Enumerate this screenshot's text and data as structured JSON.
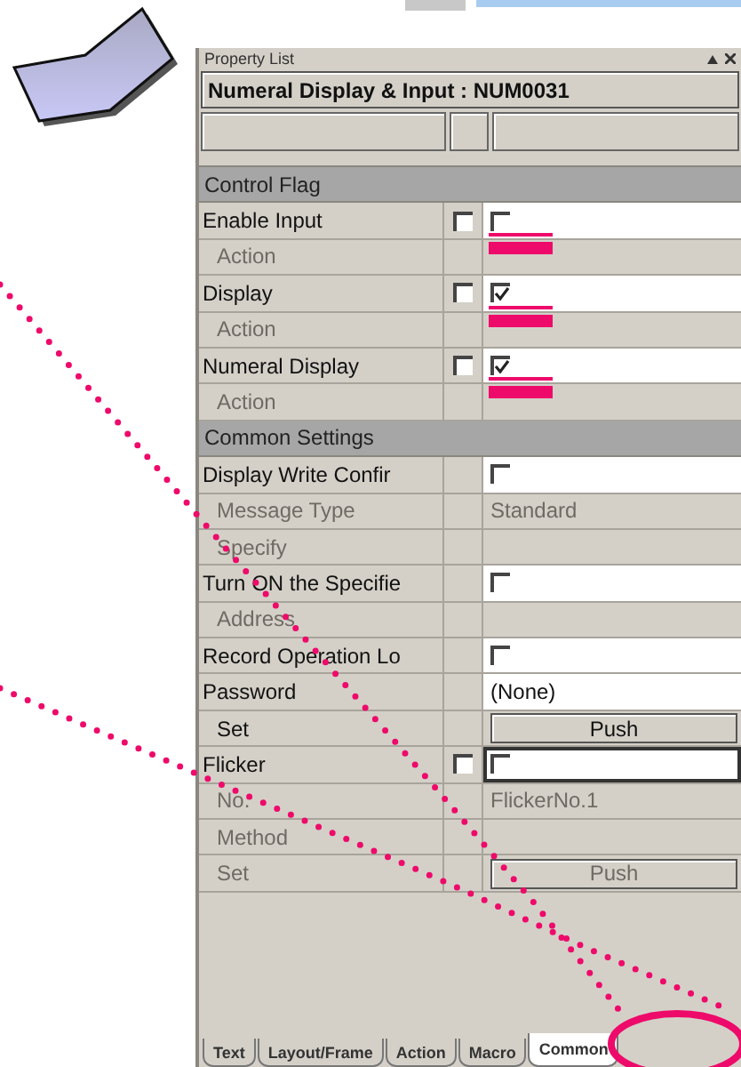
{
  "panel": {
    "title": "Property List",
    "object": "Numeral Display & Input : NUM0031"
  },
  "rows": [
    {
      "kind": "section",
      "label": "Control Flag"
    },
    {
      "kind": "property",
      "label": "Enable Input",
      "disabled": false,
      "sub": false,
      "flag": {
        "checked": false
      },
      "value": {
        "kind": "checkbox",
        "checked": false,
        "focused": false,
        "highlighted": true
      }
    },
    {
      "kind": "property",
      "label": "Action",
      "disabled": true,
      "sub": true,
      "value": {
        "kind": "none"
      }
    },
    {
      "kind": "property",
      "label": "Display",
      "disabled": false,
      "sub": false,
      "flag": {
        "checked": false
      },
      "value": {
        "kind": "checkbox",
        "checked": true,
        "focused": false,
        "highlighted": true
      }
    },
    {
      "kind": "property",
      "label": "Action",
      "disabled": true,
      "sub": true,
      "value": {
        "kind": "none"
      }
    },
    {
      "kind": "property",
      "label": "Numeral Display",
      "disabled": false,
      "sub": false,
      "flag": {
        "checked": false
      },
      "value": {
        "kind": "checkbox",
        "checked": true,
        "focused": false,
        "highlighted": true
      }
    },
    {
      "kind": "property",
      "label": "Action",
      "disabled": true,
      "sub": true,
      "value": {
        "kind": "none"
      }
    },
    {
      "kind": "section",
      "label": "Common Settings"
    },
    {
      "kind": "property",
      "label": "Display Write Confir",
      "disabled": false,
      "sub": false,
      "value": {
        "kind": "checkbox",
        "checked": false,
        "focused": false,
        "highlighted": false
      }
    },
    {
      "kind": "property",
      "label": "Message Type",
      "disabled": true,
      "sub": true,
      "value": {
        "kind": "text",
        "text": "Standard"
      }
    },
    {
      "kind": "property",
      "label": "Specify",
      "disabled": true,
      "sub": true,
      "value": {
        "kind": "none"
      }
    },
    {
      "kind": "property",
      "label": "Turn ON the Specifie",
      "disabled": false,
      "sub": false,
      "value": {
        "kind": "checkbox",
        "checked": false,
        "focused": false,
        "highlighted": false
      }
    },
    {
      "kind": "property",
      "label": "Address",
      "disabled": true,
      "sub": true,
      "value": {
        "kind": "none"
      }
    },
    {
      "kind": "property",
      "label": "Record Operation Lo",
      "disabled": false,
      "sub": false,
      "value": {
        "kind": "checkbox",
        "checked": false,
        "focused": false,
        "highlighted": false
      }
    },
    {
      "kind": "property",
      "label": "Password",
      "disabled": false,
      "sub": false,
      "value": {
        "kind": "text",
        "text": "(None)"
      }
    },
    {
      "kind": "property",
      "label": "Set",
      "disabled": false,
      "sub": true,
      "value": {
        "kind": "button",
        "text": "Push"
      }
    },
    {
      "kind": "property",
      "label": "Flicker",
      "disabled": false,
      "sub": false,
      "flag": {
        "checked": false
      },
      "value": {
        "kind": "checkbox",
        "checked": false,
        "focused": true,
        "highlighted": false
      }
    },
    {
      "kind": "property",
      "label": "No.",
      "disabled": true,
      "sub": true,
      "value": {
        "kind": "text",
        "text": "FlickerNo.1"
      }
    },
    {
      "kind": "property",
      "label": "Method",
      "disabled": true,
      "sub": true,
      "value": {
        "kind": "none"
      }
    },
    {
      "kind": "property",
      "label": "Set",
      "disabled": true,
      "sub": true,
      "value": {
        "kind": "button",
        "text": "Push"
      }
    }
  ],
  "tabs": [
    {
      "label": "Text",
      "selected": false
    },
    {
      "label": "Layout/Frame",
      "selected": false
    },
    {
      "label": "Action",
      "selected": false
    },
    {
      "label": "Macro",
      "selected": false
    },
    {
      "label": "Common",
      "selected": true
    }
  ]
}
